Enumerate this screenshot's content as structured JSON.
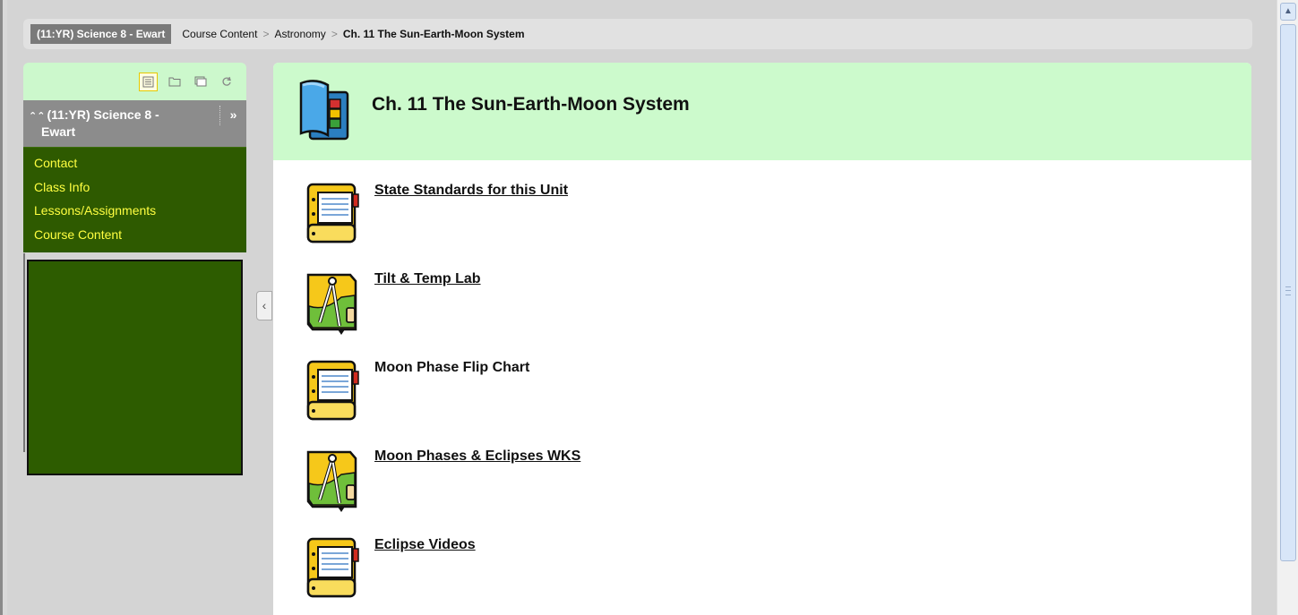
{
  "breadcrumb": {
    "home": "(11:YR) Science 8 - Ewart",
    "items": [
      "Course Content",
      "Astronomy"
    ],
    "current": "Ch. 11 The Sun-Earth-Moon System",
    "separator": ">"
  },
  "sidebar": {
    "tools": [
      "list-view-icon",
      "folder-icon",
      "window-icon",
      "refresh-icon"
    ],
    "title_line1": "(11:YR) Science 8 -",
    "title_line2": "Ewart",
    "collapse_glyph": "»",
    "links": [
      {
        "label": "Contact"
      },
      {
        "label": "Class Info"
      },
      {
        "label": "Lessons/Assignments"
      },
      {
        "label": "Course Content"
      }
    ]
  },
  "main": {
    "title": "Ch. 11 The Sun-Earth-Moon System",
    "items": [
      {
        "label": "State Standards for this Unit",
        "icon": "notebook-icon",
        "link": true
      },
      {
        "label": "Tilt & Temp Lab",
        "icon": "drafting-compass-icon",
        "link": true
      },
      {
        "label": "Moon Phase Flip Chart",
        "icon": "notebook-icon",
        "link": false
      },
      {
        "label": "Moon Phases & Eclipses WKS",
        "icon": "drafting-compass-icon",
        "link": true
      },
      {
        "label": "Eclipse Videos",
        "icon": "notebook-icon",
        "link": true
      }
    ]
  },
  "colors": {
    "sidebar_green": "#2e5a00",
    "link_yellow": "#ffff40",
    "header_mint": "#ccfacc"
  }
}
